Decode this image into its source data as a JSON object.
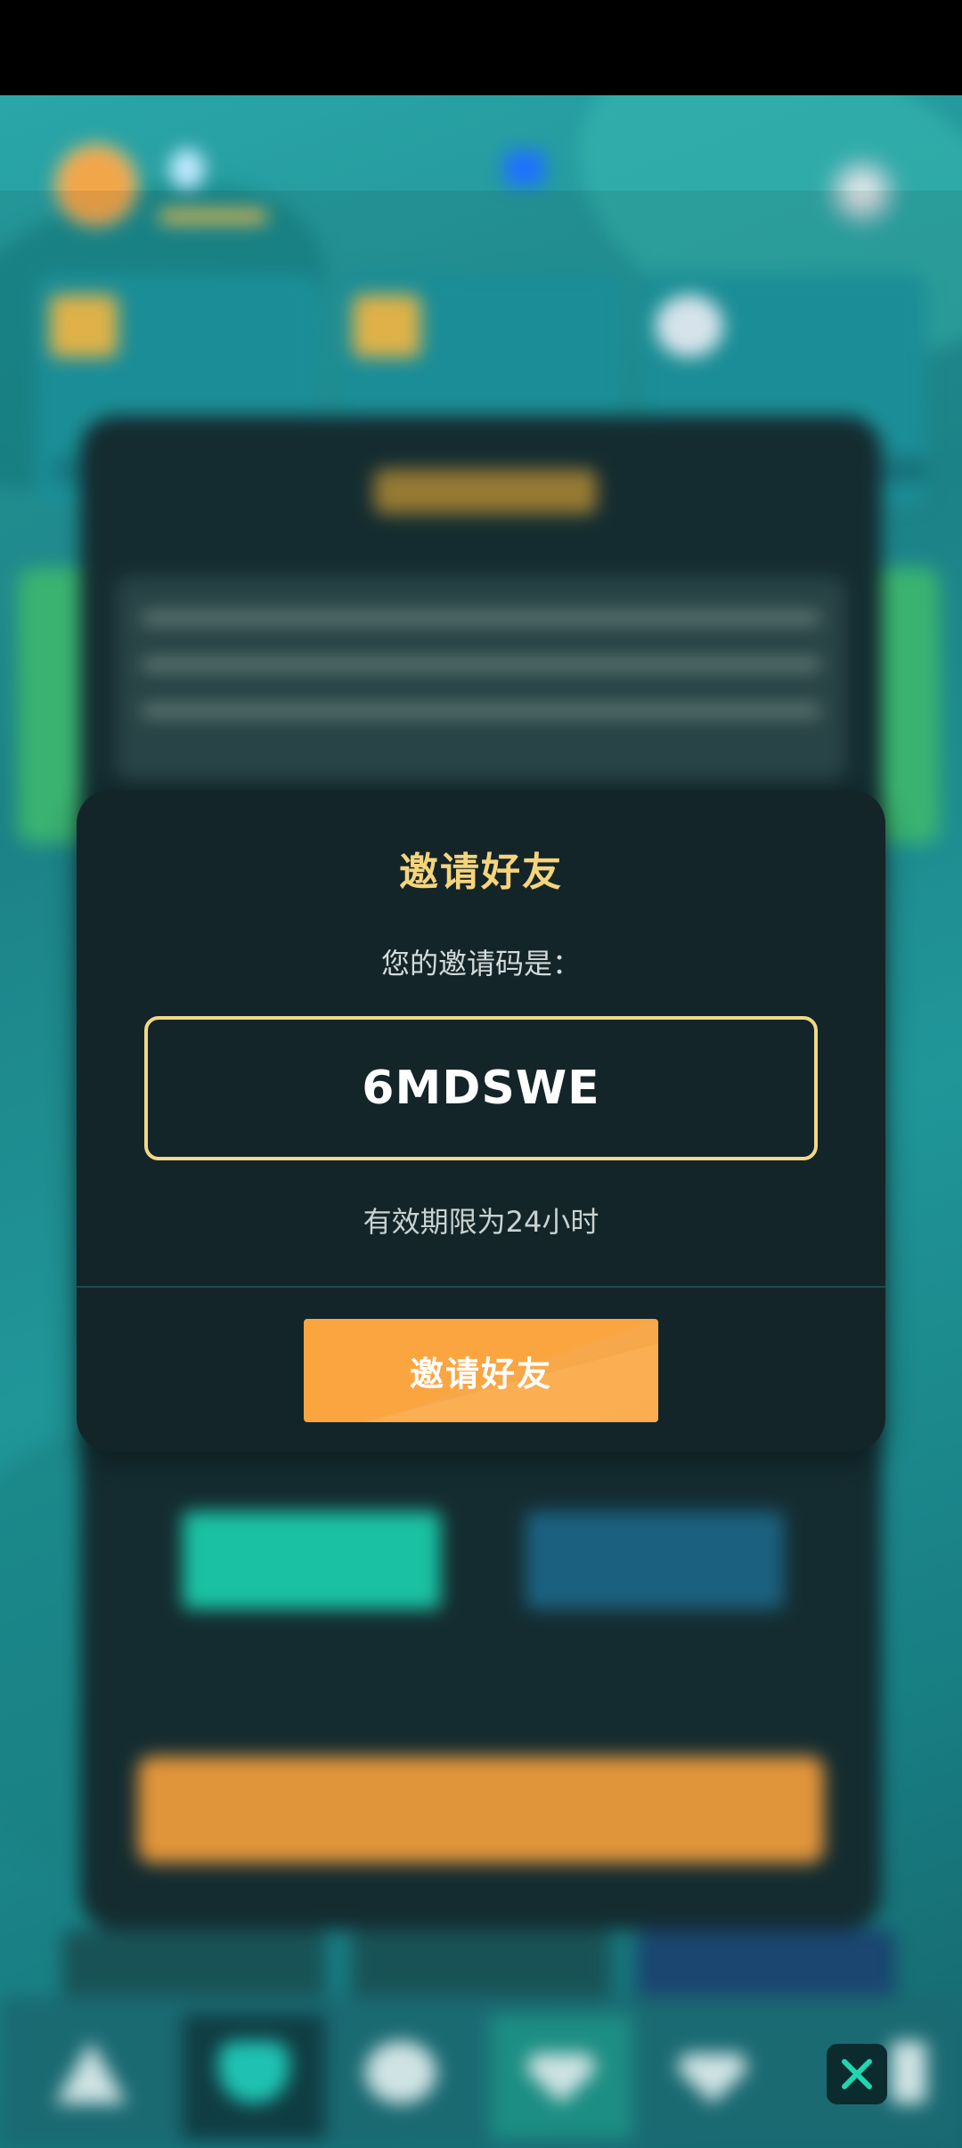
{
  "modal": {
    "title": "邀请好友",
    "code_caption": "您的邀请码是：",
    "invite_code": "6MDSWE",
    "validity_note": "有效期限为24小时",
    "button_label": "邀请好友"
  },
  "colors": {
    "modal_bg": "#142529",
    "title_gold": "#f5d47c",
    "code_border": "#f2d889",
    "button_orange": "#fba541",
    "background_teal": "#2aa6a8"
  },
  "bottom_nav": {
    "items": [
      "home-icon",
      "shield-icon",
      "coin-icon",
      "diamond-icon",
      "gem-icon"
    ]
  },
  "icons": {
    "close": "close-icon"
  }
}
